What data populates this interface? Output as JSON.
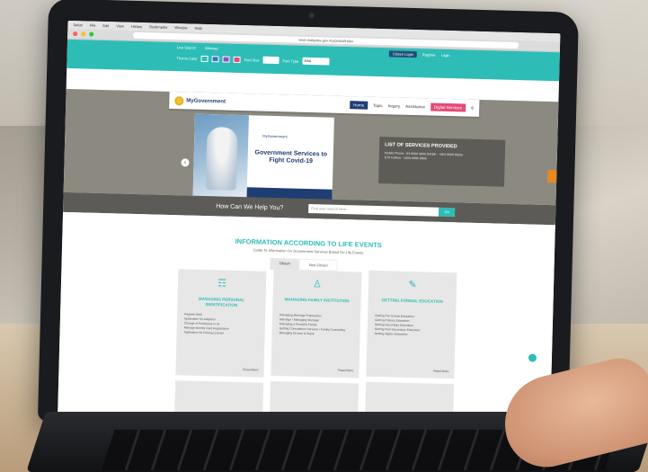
{
  "browser": {
    "menu": [
      "Safari",
      "File",
      "Edit",
      "View",
      "History",
      "Bookmarks",
      "Window",
      "Help"
    ],
    "url": "www.malaysia.gov.my/portal/index"
  },
  "header": {
    "links": [
      "Live Search",
      "Sitemap"
    ],
    "theme_label": "Theme Color",
    "font_label": "Font Size",
    "font_type_label": "Font Type",
    "font_type_value": "Arial",
    "login_button": "Citizen Login",
    "register": "Register",
    "login": "Login",
    "logo_text": "MyGovernment"
  },
  "nav": {
    "home": "Home",
    "items": [
      "Topic",
      "Inquiry",
      "Assistance"
    ],
    "digital": "Digital Services"
  },
  "hero": {
    "slide_logo": "MyGovernment",
    "slide_title": "Government Services to Fight Covid-19",
    "services_title": "LIST OF SERVICES PROVIDED",
    "services_lines": [
      "Mobile Phone : 03-8000 8000 (FREE : +603 8000 8000)",
      "ETA Hotline : 1800-8888-8888"
    ]
  },
  "help": {
    "prompt": "How Can We Help You?",
    "placeholder": "Find your search here",
    "button": "Go"
  },
  "info": {
    "title": "INFORMATION ACCORDING TO LIFE EVENTS",
    "subtitle": "Guide To Information On Government Services Based On Life Events",
    "toggle_active": "Citizen",
    "toggle_inactive": "Non-Citizen",
    "cards": [
      {
        "title": "MANAGING PERSONAL IDENTIFICATION",
        "icon": "id-card-icon",
        "items": [
          "Register Birth",
          "Application for Adoption",
          "Change of Particulars in ID",
          "Manage Identity Card Registration",
          "Application for Driving License"
        ],
        "more": "Read More"
      },
      {
        "title": "MANAGING FAMILY INSTITUTION",
        "icon": "family-icon",
        "items": [
          "Managing Marriage Preparation",
          "Marriage / Managing Marriage",
          "Managing a Peaceful Family",
          "Getting Consultation Services / Family Counseling",
          "Managing Divorce & Rujuk"
        ],
        "more": "Read More"
      },
      {
        "title": "GETTING FORMAL EDUCATION",
        "icon": "education-icon",
        "items": [
          "Getting Pre-School Education",
          "Getting Primary Education",
          "Getting Secondary Education",
          "Getting Post-Secondary Education",
          "Getting Higher Education"
        ],
        "more": "Read More"
      }
    ]
  }
}
